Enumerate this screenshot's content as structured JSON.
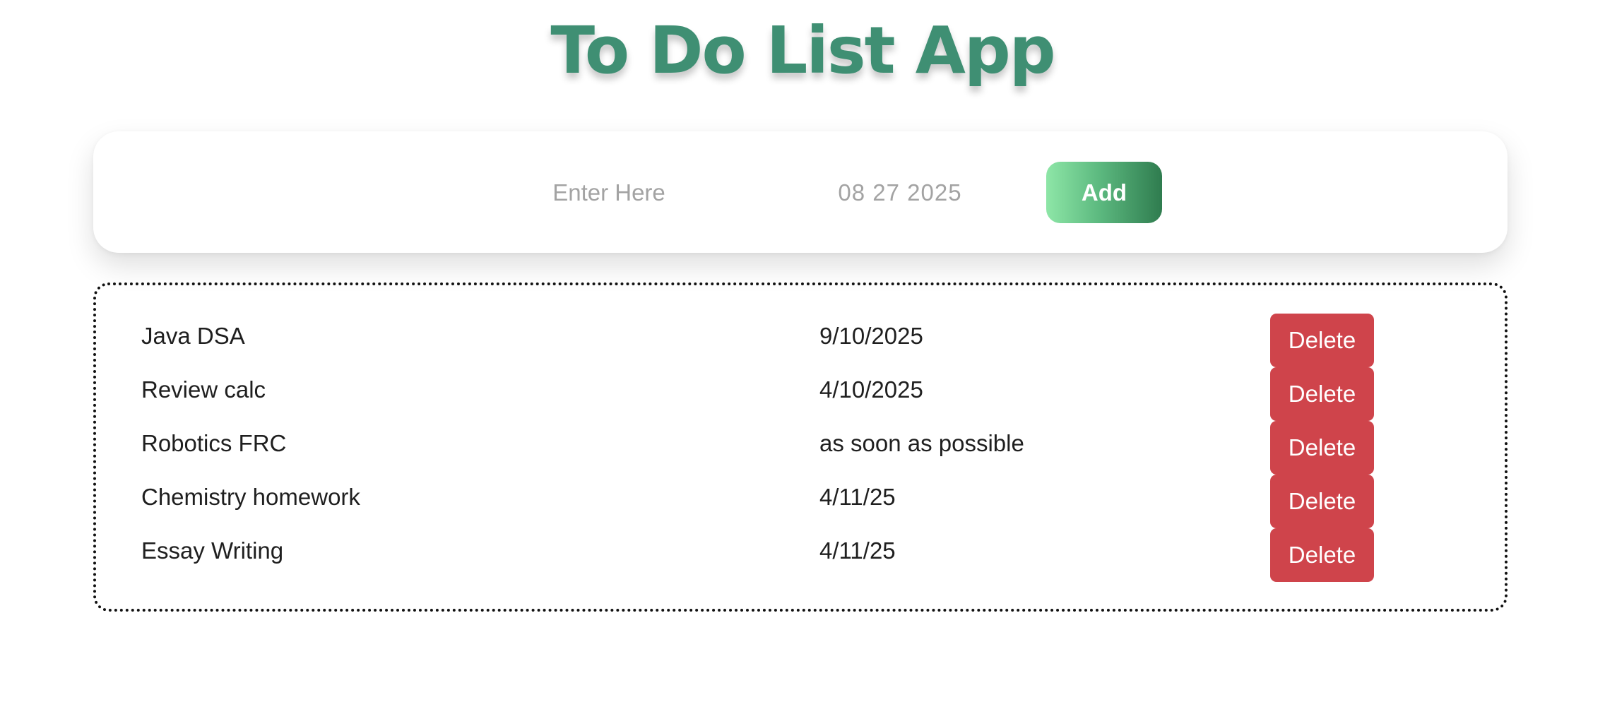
{
  "app": {
    "title": "To Do List App"
  },
  "form": {
    "task_placeholder": "Enter Here",
    "task_value": "",
    "date_value": "08 27 2025",
    "add_label": "Add"
  },
  "todos": [
    {
      "name": "Java DSA",
      "date": "9/10/2025",
      "delete_label": "Delete"
    },
    {
      "name": "Review calc",
      "date": "4/10/2025",
      "delete_label": "Delete"
    },
    {
      "name": "Robotics FRC",
      "date": "as soon as possible",
      "delete_label": "Delete"
    },
    {
      "name": "Chemistry homework",
      "date": "4/11/25",
      "delete_label": "Delete"
    },
    {
      "name": "Essay Writing",
      "date": "4/11/25",
      "delete_label": "Delete"
    }
  ],
  "colors": {
    "title": "#3f8f73",
    "add_gradient_start": "#8ee6a7",
    "add_gradient_end": "#2f7c4f",
    "delete": "#cf444b"
  }
}
